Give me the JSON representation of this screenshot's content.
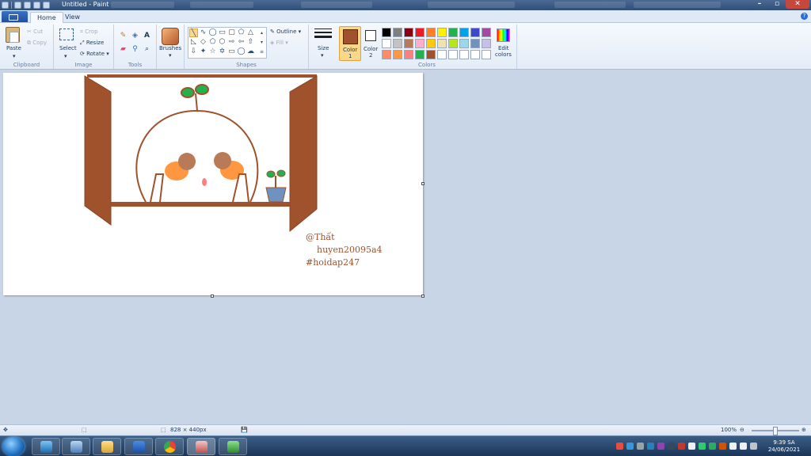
{
  "window": {
    "title": "Untitled - Paint"
  },
  "tabs": [
    {
      "label": "Home",
      "active": true
    },
    {
      "label": "View",
      "active": false
    }
  ],
  "ribbon": {
    "clipboard": {
      "group": "Clipboard",
      "paste": "Paste",
      "cut": "Cut",
      "copy": "Copy"
    },
    "image": {
      "group": "Image",
      "select": "Select",
      "crop": "Crop",
      "resize": "Resize",
      "rotate": "Rotate"
    },
    "tools": {
      "group": "Tools"
    },
    "brushes": {
      "label": "Brushes"
    },
    "shapes": {
      "group": "Shapes",
      "outline": "Outline",
      "fill": "Fill"
    },
    "size": {
      "label": "Size"
    },
    "colors": {
      "group": "Colors",
      "color1_label": "Color",
      "color1_num": "1",
      "color2_label": "Color",
      "color2_num": "2",
      "color1_value": "#a0522d",
      "color2_value": "#ffffff",
      "edit_line1": "Edit",
      "edit_line2": "colors",
      "palette": [
        "#000000",
        "#7f7f7f",
        "#880015",
        "#ed1c24",
        "#ff7f27",
        "#fff200",
        "#22b14c",
        "#00a2e8",
        "#3f48cc",
        "#a349a4",
        "#ffffff",
        "#c3c3c3",
        "#b97a57",
        "#ffaec9",
        "#ffc90e",
        "#efe4b0",
        "#b5e61d",
        "#99d9ea",
        "#7092be",
        "#c8bfe7",
        "#ff8a65",
        "#ff9640",
        "#ff7f7f",
        "#22b14c",
        "#a0522d",
        "#ffffff",
        "#ffffff",
        "#ffffff",
        "#ffffff",
        "#ffffff"
      ]
    }
  },
  "canvas_text": {
    "line1": "@Thất",
    "line2": "huyen20095a4",
    "line3": "#hoidap247"
  },
  "status": {
    "dimensions": "828 × 440px",
    "zoom": "100%"
  },
  "taskbar": {
    "time": "9:39 SA",
    "date": "24/06/2021"
  }
}
